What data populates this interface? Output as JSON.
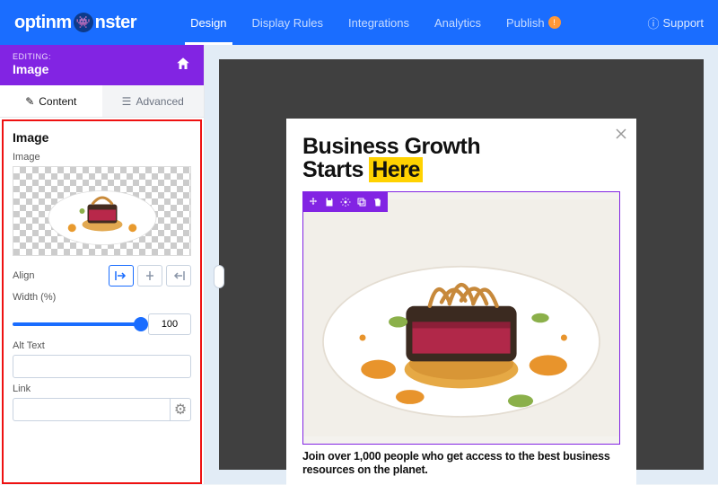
{
  "brand": "optinmonster",
  "nav": {
    "items": [
      "Design",
      "Display Rules",
      "Integrations",
      "Analytics"
    ],
    "publish": "Publish",
    "active": "Design"
  },
  "support": "Support",
  "editing": {
    "label": "EDITING:",
    "value": "Image"
  },
  "subtabs": {
    "content": "Content",
    "advanced": "Advanced"
  },
  "panel": {
    "title": "Image",
    "image_label": "Image",
    "align_label": "Align",
    "align_value": "left",
    "width_label": "Width (%)",
    "width_value": "100",
    "alt_label": "Alt Text",
    "alt_value": "",
    "link_label": "Link",
    "link_value": ""
  },
  "popup": {
    "headline_1": "Business Growth",
    "headline_2a": "Starts ",
    "headline_2b": "Here",
    "caption": "Join over 1,000 people who get access to the best business resources on the planet."
  },
  "colors": {
    "primary": "#1a6dff",
    "accent": "#8224e3",
    "highlight": "#ffd200"
  }
}
